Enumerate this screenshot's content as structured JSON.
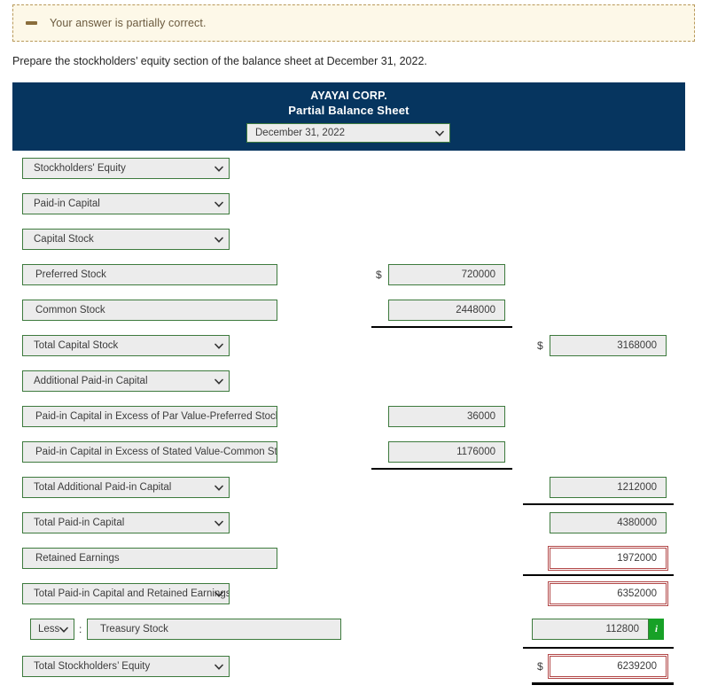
{
  "alert": {
    "icon": "dash-icon",
    "message": "Your answer is partially correct."
  },
  "instruction": "Prepare the stockholders’ equity section of the balance sheet at December 31, 2022.",
  "sheet": {
    "company": "AYAYAI CORP.",
    "statement": "Partial Balance Sheet",
    "date_value": "December 31, 2022"
  },
  "colors": {
    "header_blue": "#06355f",
    "field_border_green": "#3d7a3d",
    "field_fill": "#ececec",
    "error_red": "#b24848",
    "info_green": "#17a127",
    "alert_bg": "#fdf8e8",
    "alert_border": "#b99a5b"
  },
  "rows": [
    {
      "type": "select",
      "label": "Stockholders' Equity"
    },
    {
      "type": "select",
      "label": "Paid-in Capital"
    },
    {
      "type": "select",
      "label": "Capital Stock"
    },
    {
      "type": "labeled",
      "label": "Preferred Stock",
      "mid_value": "720000",
      "mid_dollar": "$"
    },
    {
      "type": "labeled",
      "label": "Common Stock",
      "mid_value": "2448000"
    },
    {
      "type": "select",
      "label": "Total Capital Stock",
      "right_value": "3168000",
      "right_dollar": "$"
    },
    {
      "type": "select",
      "label": "Additional Paid-in Capital"
    },
    {
      "type": "labeled",
      "label": "Paid-in Capital in Excess of Par Value-Preferred Stock",
      "mid_value": "36000"
    },
    {
      "type": "labeled",
      "label": "Paid-in Capital in Excess of Stated Value-Common Stock",
      "mid_value": "1176000"
    },
    {
      "type": "select",
      "label": "Total Additional Paid-in Capital",
      "right_value": "1212000"
    },
    {
      "type": "select",
      "label": "Total Paid-in Capital",
      "right_value": "4380000"
    },
    {
      "type": "labeled",
      "label": "Retained Earnings",
      "right_value": "1972000",
      "right_wrong": true
    },
    {
      "type": "select",
      "label": "Total Paid-in Capital and Retained Earnings",
      "right_value": "6352000",
      "right_wrong": true
    },
    {
      "type": "treasury",
      "less_label": "Less",
      "colon": ":",
      "label": "Treasury Stock",
      "right_value": "112800",
      "info": "i"
    },
    {
      "type": "select",
      "label": "Total Stockholders’ Equity",
      "right_value": "6239200",
      "right_dollar": "$",
      "right_wrong": true
    }
  ]
}
